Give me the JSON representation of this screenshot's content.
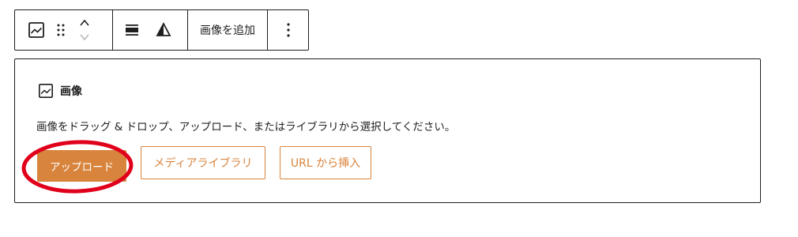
{
  "toolbar": {
    "add_image_label": "画像を追加",
    "icons": [
      "image-icon",
      "drag-handle-icon",
      "move-up-icon",
      "move-down-icon",
      "align-icon",
      "duotone-filter-icon",
      "more-options-icon"
    ]
  },
  "placeholder": {
    "title": "画像",
    "instructions": "画像をドラッグ & ドロップ、アップロード、またはライブラリから選択してください。",
    "upload_label": "アップロード",
    "media_library_label": "メディアライブラリ",
    "insert_url_label": "URL から挿入"
  },
  "colors": {
    "accent": "#d8843c",
    "border": "#1e1e1e",
    "annotation": "#e0001b"
  }
}
